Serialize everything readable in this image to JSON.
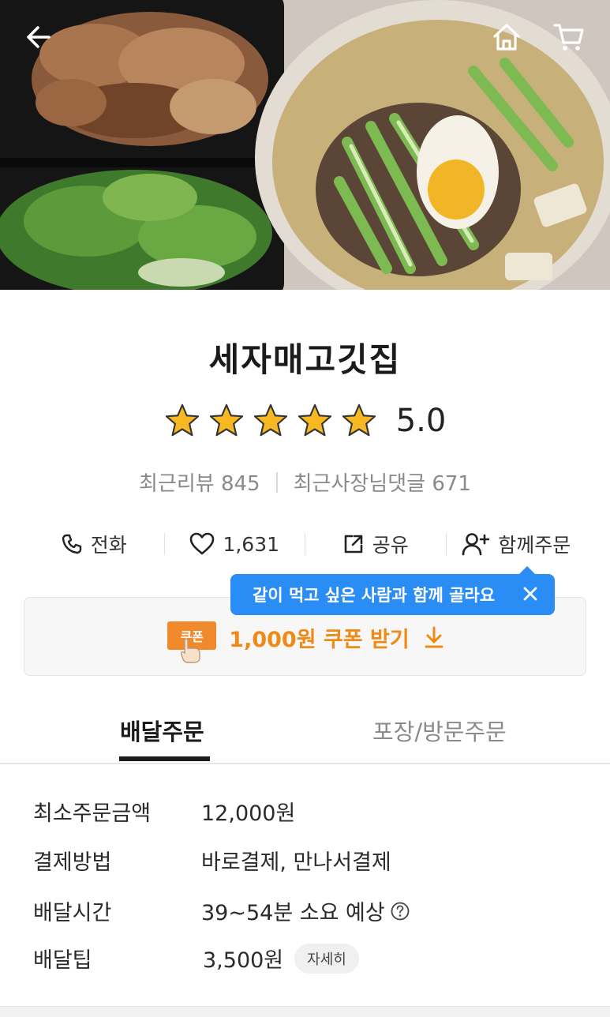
{
  "nav": {
    "back_icon": "arrow-left-icon",
    "home_icon": "home-icon",
    "cart_icon": "cart-icon"
  },
  "store": {
    "name": "세자매고깃집",
    "rating": "5.0",
    "stars": 5,
    "recent_reviews_label": "최근리뷰 845",
    "owner_replies_label": "최근사장님댓글 671"
  },
  "actions": {
    "call": "전화",
    "like_count": "1,631",
    "share": "공유",
    "group_order": "함께주문"
  },
  "tooltip": {
    "text": "같이 먹고 싶은 사람과 함께 골라요"
  },
  "coupon": {
    "badge": "쿠폰",
    "text": "1,000원 쿠폰 받기"
  },
  "tabs": [
    {
      "label": "배달주문",
      "active": true
    },
    {
      "label": "포장/방문주문",
      "active": false
    }
  ],
  "info": {
    "min_order_label": "최소주문금액",
    "min_order_value": "12,000원",
    "payment_label": "결제방법",
    "payment_value": "바로결제, 만나서결제",
    "delivery_time_label": "배달시간",
    "delivery_time_value": "39~54분 소요 예상",
    "delivery_tip_label": "배달팁",
    "delivery_tip_value": "3,500원",
    "detail_button": "자세히"
  },
  "colors": {
    "accent_orange": "#f08a17",
    "tooltip_blue": "#2a8df5",
    "star_yellow": "#f7b821"
  }
}
